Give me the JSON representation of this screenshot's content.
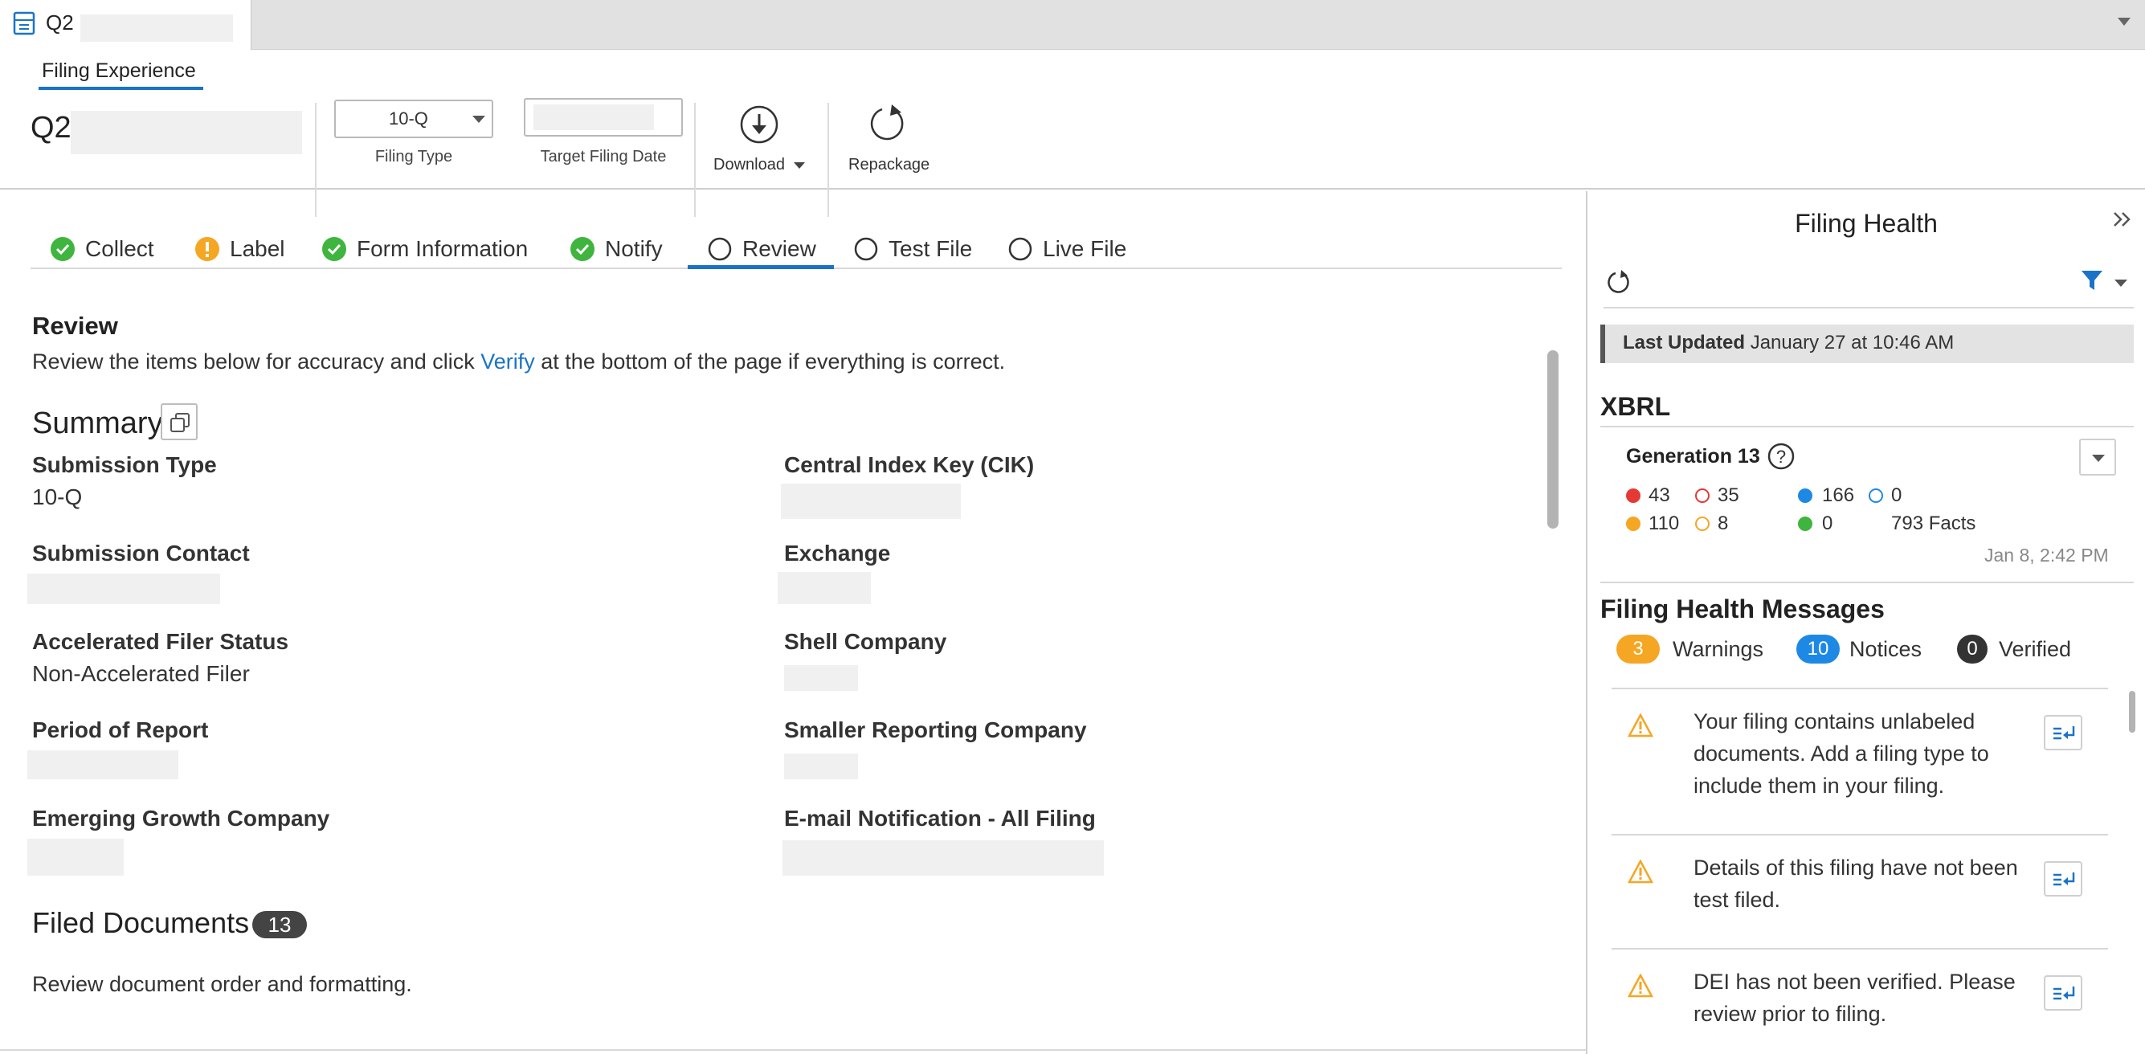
{
  "tab": {
    "title": "Q2"
  },
  "header": {
    "subtab": "Filing Experience",
    "title": "Q2",
    "filing_type_value": "10-Q",
    "filing_type_label": "Filing Type",
    "target_date_label": "Target Filing Date",
    "download_label": "Download",
    "repackage_label": "Repackage"
  },
  "steps": [
    {
      "label": "Collect",
      "status": "complete"
    },
    {
      "label": "Label",
      "status": "warning"
    },
    {
      "label": "Form Information",
      "status": "complete"
    },
    {
      "label": "Notify",
      "status": "complete"
    },
    {
      "label": "Review",
      "status": "active"
    },
    {
      "label": "Test File",
      "status": "pending"
    },
    {
      "label": "Live File",
      "status": "pending"
    }
  ],
  "review": {
    "heading": "Review",
    "intro_before": "Review the items below for accuracy and click",
    "intro_link": "Verify",
    "intro_after": "at the bottom of the page if everything is correct."
  },
  "summary": {
    "heading": "Summary",
    "fields": {
      "submission_type_label": "Submission Type",
      "submission_type_value": "10-Q",
      "cik_label": "Central Index Key (CIK)",
      "submission_contact_label": "Submission Contact",
      "exchange_label": "Exchange",
      "filer_status_label": "Accelerated Filer Status",
      "filer_status_value": "Non-Accelerated Filer",
      "shell_label": "Shell Company",
      "period_label": "Period of Report",
      "smaller_label": "Smaller Reporting Company",
      "emerging_label": "Emerging Growth Company",
      "email_label": "E-mail Notification - All Filing"
    }
  },
  "filed_documents": {
    "heading": "Filed Documents",
    "count": "13",
    "description": "Review document order and formatting."
  },
  "health": {
    "title": "Filing Health",
    "last_updated_label": "Last Updated",
    "last_updated_value": "January 27 at 10:46 AM",
    "xbrl_heading": "XBRL",
    "generation": "Generation 13",
    "stats": {
      "red_filled": "43",
      "red_outline": "35",
      "blue_filled": "166",
      "blue_outline": "0",
      "orange_filled": "110",
      "orange_outline": "8",
      "green_filled": "0",
      "facts": "793 Facts"
    },
    "generation_date": "Jan 8, 2:42 PM",
    "messages_heading": "Filing Health Messages",
    "warnings_count": "3",
    "warnings_label": "Warnings",
    "notices_count": "10",
    "notices_label": "Notices",
    "verified_count": "0",
    "verified_label": "Verified",
    "messages": [
      {
        "l1": "Your filing contains unlabeled",
        "l2": "documents. Add a filing type to",
        "l3": "include them in your filing."
      },
      {
        "l1": "Details of this filing have not been",
        "l2": "test filed."
      },
      {
        "l1": "DEI has not been verified. Please",
        "l2": "review prior to filing."
      }
    ]
  },
  "colors": {
    "accent": "#1a73c9",
    "green": "#3fb53f",
    "orange": "#f5a623",
    "red": "#e53935",
    "blue": "#1e88e5"
  }
}
